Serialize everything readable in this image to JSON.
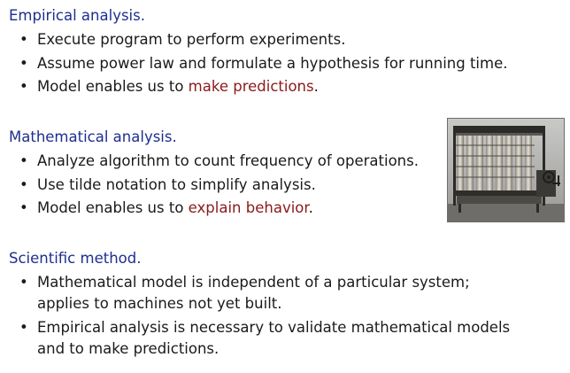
{
  "sections": [
    {
      "heading": "Empirical analysis",
      "bullets": [
        {
          "text": "Execute program to perform experiments."
        },
        {
          "text": "Assume power law and formulate a hypothesis for running time."
        },
        {
          "prefix": "Model enables us to ",
          "highlight": "make predictions",
          "suffix": "."
        }
      ]
    },
    {
      "heading": "Mathematical analysis",
      "bullets": [
        {
          "text": "Analyze algorithm to count frequency of operations."
        },
        {
          "text": "Use tilde notation to simplify analysis."
        },
        {
          "prefix": "Model enables us to ",
          "highlight": "explain behavior",
          "suffix": "."
        }
      ]
    },
    {
      "heading": "Scientific method",
      "bullets": [
        {
          "line1": "Mathematical model is independent of a particular system;",
          "line2": "applies to machines not yet built."
        },
        {
          "line1": "Empirical analysis is necessary to validate mathematical models",
          "line2": "and to make predictions."
        }
      ]
    }
  ],
  "punctuation": ".",
  "image": {
    "subject": "difference-engine-photo"
  },
  "colors": {
    "heading": "#1e2f8f",
    "highlight": "#8b1a1a",
    "body": "#1a1a1a"
  }
}
